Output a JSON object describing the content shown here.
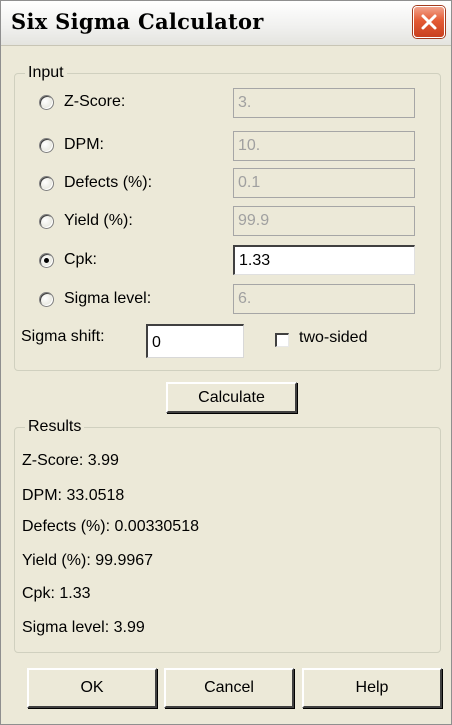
{
  "window": {
    "title": "Six Sigma Calculator"
  },
  "input": {
    "legend": "Input",
    "options": [
      {
        "label": "Z-Score:",
        "value": "3.",
        "selected": false
      },
      {
        "label": "DPM:",
        "value": "10.",
        "selected": false
      },
      {
        "label": "Defects (%):",
        "value": "0.1",
        "selected": false
      },
      {
        "label": "Yield (%):",
        "value": "99.9",
        "selected": false
      },
      {
        "label": "Cpk:",
        "value": "1.33",
        "selected": true
      },
      {
        "label": "Sigma level:",
        "value": "6.",
        "selected": false
      }
    ],
    "sigma_shift_label": "Sigma shift:",
    "sigma_shift_value": "0",
    "two_sided_label": "two-sided",
    "two_sided_checked": false
  },
  "calculate_label": "Calculate",
  "results": {
    "legend": "Results",
    "lines": [
      "Z-Score: 3.99",
      "DPM: 33.0518",
      "Defects (%): 0.00330518",
      "Yield (%): 99.9967",
      "Cpk: 1.33",
      "Sigma level: 3.99"
    ]
  },
  "buttons": {
    "ok": "OK",
    "cancel": "Cancel",
    "help": "Help"
  },
  "colors": {
    "close_button": "#e45b35",
    "dialog_bg": "#ece9d8"
  }
}
